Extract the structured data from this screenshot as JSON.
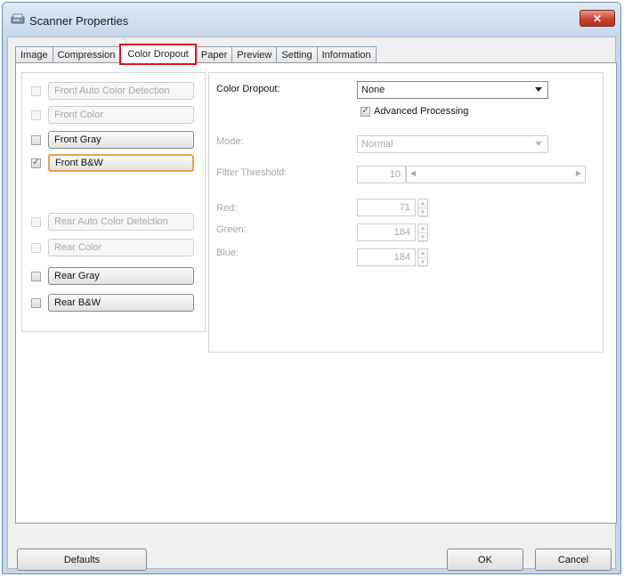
{
  "window": {
    "title": "Scanner Properties",
    "close_glyph": "✕"
  },
  "tabs": [
    {
      "label": "Image"
    },
    {
      "label": "Compression"
    },
    {
      "label": "Color Dropout",
      "active": true
    },
    {
      "label": "Paper"
    },
    {
      "label": "Preview"
    },
    {
      "label": "Setting"
    },
    {
      "label": "Information"
    }
  ],
  "options": {
    "front_auto": {
      "label": "Front Auto Color Detection",
      "checked": false,
      "enabled": false
    },
    "front_color": {
      "label": "Front Color",
      "checked": false,
      "enabled": false
    },
    "front_gray": {
      "label": "Front Gray",
      "checked": false,
      "enabled": true
    },
    "front_bw": {
      "label": "Front B&W",
      "checked": true,
      "enabled": true
    },
    "rear_auto": {
      "label": "Rear Auto Color Detection",
      "checked": false,
      "enabled": false
    },
    "rear_color": {
      "label": "Rear Color",
      "checked": false,
      "enabled": false
    },
    "rear_gray": {
      "label": "Rear Gray",
      "checked": false,
      "enabled": true
    },
    "rear_bw": {
      "label": "Rear B&W",
      "checked": false,
      "enabled": true
    }
  },
  "dropout": {
    "label": "Color Dropout:",
    "value": "None",
    "advanced_label": "Advanced Processing",
    "advanced_checked": true,
    "mode_label": "Mode:",
    "mode_value": "Normal",
    "filter_label": "Filter Threshold:",
    "filter_value": "10",
    "red_label": "Red:",
    "red_value": "71",
    "green_label": "Green:",
    "green_value": "184",
    "blue_label": "Blue:",
    "blue_value": "184"
  },
  "buttons": {
    "defaults": "Defaults",
    "ok": "OK",
    "cancel": "Cancel"
  },
  "icons": {
    "app": "scanner-icon",
    "check": "✓",
    "spin_up": "▲",
    "spin_down": "▼",
    "slider_left": "◀",
    "slider_right": "▶"
  }
}
